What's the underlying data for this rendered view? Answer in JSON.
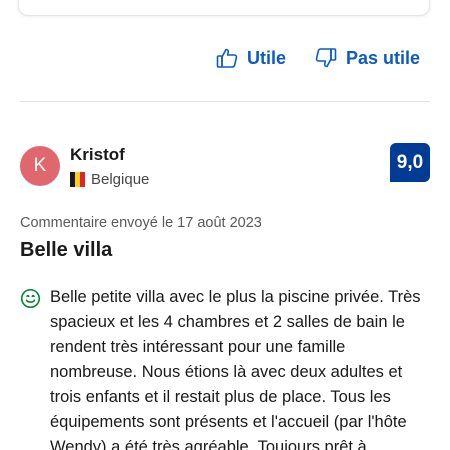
{
  "feedback": {
    "helpful_label": "Utile",
    "not_helpful_label": "Pas utile"
  },
  "reviewer": {
    "initial": "K",
    "name": "Kristof",
    "country": "Belgique"
  },
  "review": {
    "score": "9,0",
    "date_line": "Commentaire envoyé le 17 août 2023",
    "title": "Belle villa",
    "positive_text": "Belle petite villa avec le plus la piscine privée. Très spacieux et les 4 chambres et 2 salles de bain le rendent très intéressant pour une famille nombreuse. Nous étions là avec deux adultes et trois enfants et il restait plus de place. Tous les équipements sont présents et l'accueil (par l'hôte Wendy) a été très agréable. Toujours prêt à"
  },
  "colors": {
    "link_blue": "#0a5ac9",
    "score_badge": "#003b95",
    "avatar_bg": "#e0676d",
    "positive_green": "#008234"
  },
  "icons": {
    "helpful": "thumbs-up-icon",
    "not_helpful": "thumbs-down-icon",
    "positive": "smile-icon",
    "flag": "belgium-flag-icon"
  }
}
